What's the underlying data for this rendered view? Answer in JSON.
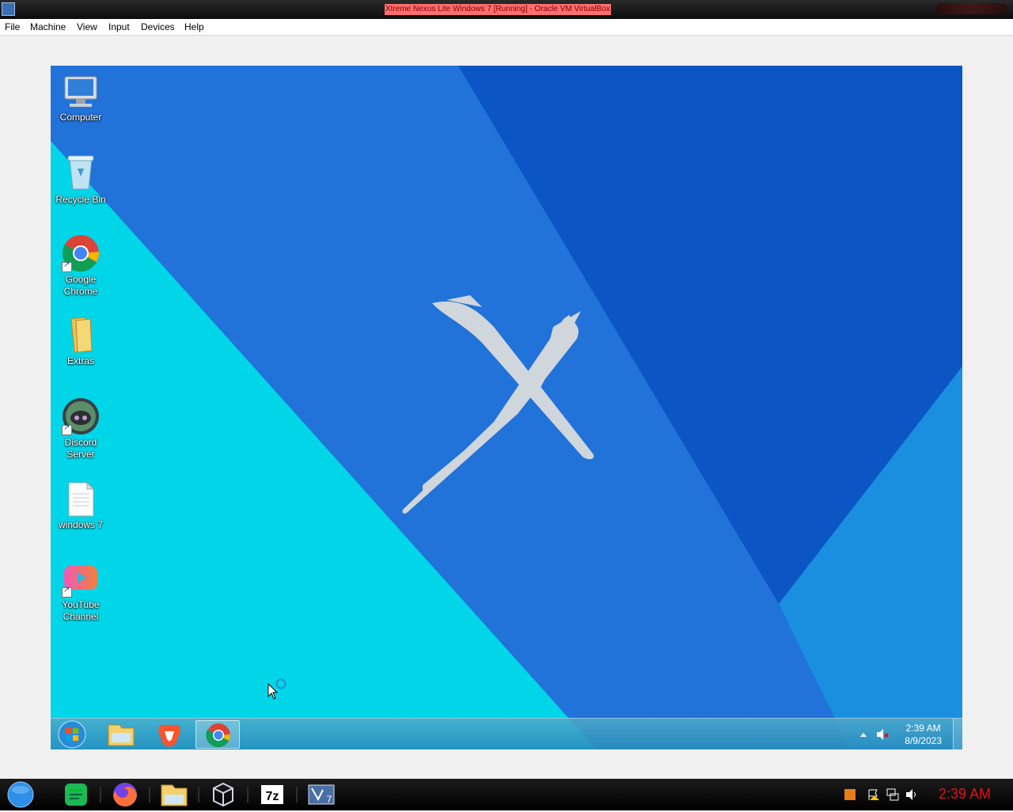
{
  "host": {
    "window_title": "Xtreme Nexus Lite Windows 7 [Running] - Oracle VM VirtualBox",
    "menu": [
      "File",
      "Machine",
      "View",
      "Input",
      "Devices",
      "Help"
    ],
    "clock": "2:39 AM",
    "taskbar_items": [
      "start-orb",
      "notes-app",
      "firefox",
      "file-explorer",
      "virtualbox",
      "7zip",
      "virtualbox-vm"
    ],
    "tray_icons": [
      "app-tray-icon",
      "action-center-icon",
      "network-icon",
      "volume-icon"
    ],
    "clock_color": "#e31212"
  },
  "guest": {
    "desktop_icons": [
      {
        "label": "Computer",
        "icon": "computer-icon"
      },
      {
        "label": "Recycle Bin",
        "icon": "recycle-bin-icon"
      },
      {
        "label": "Google Chrome",
        "icon": "chrome-icon",
        "shortcut": true
      },
      {
        "label": "Extras",
        "icon": "folder-icon"
      },
      {
        "label": "Discord Server",
        "icon": "discord-icon",
        "shortcut": true
      },
      {
        "label": "windows 7",
        "icon": "text-file-icon"
      },
      {
        "label": "YouTube Channel",
        "icon": "youtube-icon",
        "shortcut": true
      }
    ],
    "taskbar": {
      "pinned": [
        "start-orb",
        "file-explorer",
        "brave",
        "chrome"
      ],
      "active": "chrome",
      "time": "2:39 AM",
      "date": "8/9/2023",
      "tray_icons": [
        "show-hidden-icons",
        "volume-muted-icon"
      ]
    },
    "wallpaper_colors": {
      "cyan": "#00d6e6",
      "blue": "#1f6fd8",
      "dark_blue": "#0b55c4",
      "mark": "#cfd6dc"
    }
  }
}
